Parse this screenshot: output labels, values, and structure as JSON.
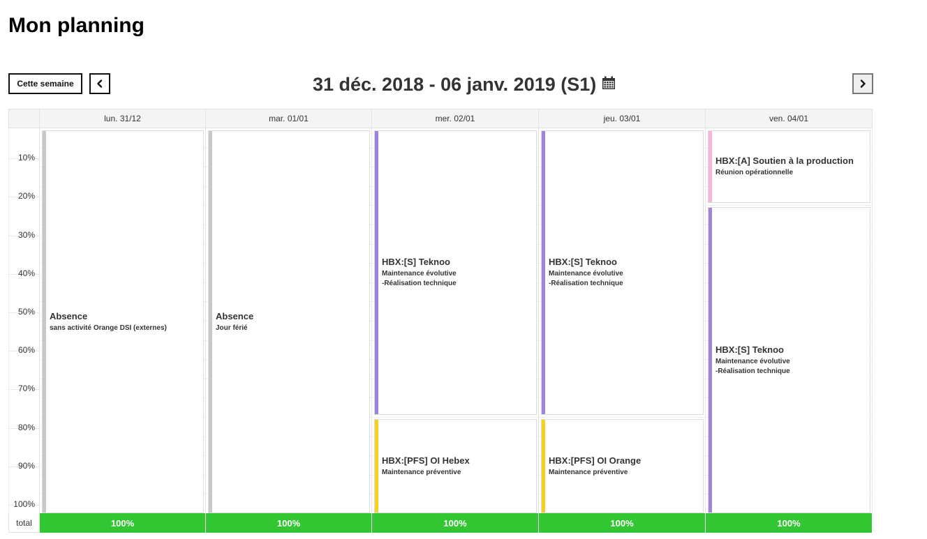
{
  "page": {
    "title": "Mon planning"
  },
  "toolbar": {
    "this_week_label": "Cette semaine",
    "prev_icon": "chevron-left-icon",
    "next_icon": "chevron-right-icon",
    "week_range": "31 déc. 2018 - 06 janv. 2019 (S1)",
    "calendar_icon": "calendar-icon"
  },
  "scale": {
    "ticks": [
      "10%",
      "20%",
      "30%",
      "40%",
      "50%",
      "60%",
      "70%",
      "80%",
      "90%",
      "100%"
    ],
    "total_label": "total"
  },
  "days": [
    {
      "label": "lun. 31/12",
      "total": "100%",
      "events": [
        {
          "title": "Absence",
          "subtitle": "sans activité Orange DSI (externes)",
          "color": "#c8c8c8",
          "start": 0,
          "end": 100
        }
      ]
    },
    {
      "label": "mar. 01/01",
      "total": "100%",
      "events": [
        {
          "title": "Absence",
          "subtitle": "Jour férié",
          "color": "#c8c8c8",
          "start": 0,
          "end": 100
        }
      ]
    },
    {
      "label": "mer. 02/01",
      "total": "100%",
      "events": [
        {
          "title": "HBX:[S] Teknoo",
          "subtitle": "Maintenance évolutive\n-Réalisation technique",
          "color": "#a184d8",
          "start": 0,
          "end": 75
        },
        {
          "title": "HBX:[PFS] OI Hebex",
          "subtitle": "Maintenance préventive",
          "color": "#f5d21e",
          "start": 75,
          "end": 100
        }
      ]
    },
    {
      "label": "jeu. 03/01",
      "total": "100%",
      "events": [
        {
          "title": "HBX:[S] Teknoo",
          "subtitle": "Maintenance évolutive\n-Réalisation technique",
          "color": "#a184d8",
          "start": 0,
          "end": 75
        },
        {
          "title": "HBX:[PFS] OI Orange",
          "subtitle": "Maintenance préventive",
          "color": "#f5d21e",
          "start": 75,
          "end": 100
        }
      ]
    },
    {
      "label": "ven. 04/01",
      "total": "100%",
      "events": [
        {
          "title": "HBX:[A] Soutien à la production",
          "subtitle": "Réunion opérationnelle",
          "color": "#f7b5dc",
          "start": 0,
          "end": 20
        },
        {
          "title": "HBX:[S] Teknoo",
          "subtitle": "Maintenance évolutive\n-Réalisation technique",
          "color": "#a184d8",
          "start": 20,
          "end": 100
        }
      ]
    }
  ]
}
